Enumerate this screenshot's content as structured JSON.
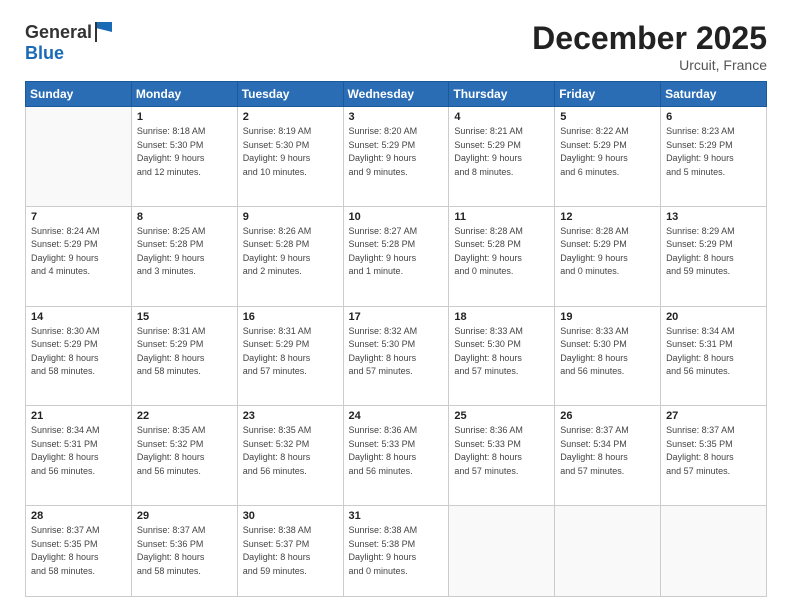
{
  "header": {
    "logo_line1": "General",
    "logo_line2": "Blue",
    "month": "December 2025",
    "location": "Urcuit, France"
  },
  "weekdays": [
    "Sunday",
    "Monday",
    "Tuesday",
    "Wednesday",
    "Thursday",
    "Friday",
    "Saturday"
  ],
  "weeks": [
    [
      {
        "day": "",
        "info": ""
      },
      {
        "day": "1",
        "info": "Sunrise: 8:18 AM\nSunset: 5:30 PM\nDaylight: 9 hours\nand 12 minutes."
      },
      {
        "day": "2",
        "info": "Sunrise: 8:19 AM\nSunset: 5:30 PM\nDaylight: 9 hours\nand 10 minutes."
      },
      {
        "day": "3",
        "info": "Sunrise: 8:20 AM\nSunset: 5:29 PM\nDaylight: 9 hours\nand 9 minutes."
      },
      {
        "day": "4",
        "info": "Sunrise: 8:21 AM\nSunset: 5:29 PM\nDaylight: 9 hours\nand 8 minutes."
      },
      {
        "day": "5",
        "info": "Sunrise: 8:22 AM\nSunset: 5:29 PM\nDaylight: 9 hours\nand 6 minutes."
      },
      {
        "day": "6",
        "info": "Sunrise: 8:23 AM\nSunset: 5:29 PM\nDaylight: 9 hours\nand 5 minutes."
      }
    ],
    [
      {
        "day": "7",
        "info": "Sunrise: 8:24 AM\nSunset: 5:29 PM\nDaylight: 9 hours\nand 4 minutes."
      },
      {
        "day": "8",
        "info": "Sunrise: 8:25 AM\nSunset: 5:28 PM\nDaylight: 9 hours\nand 3 minutes."
      },
      {
        "day": "9",
        "info": "Sunrise: 8:26 AM\nSunset: 5:28 PM\nDaylight: 9 hours\nand 2 minutes."
      },
      {
        "day": "10",
        "info": "Sunrise: 8:27 AM\nSunset: 5:28 PM\nDaylight: 9 hours\nand 1 minute."
      },
      {
        "day": "11",
        "info": "Sunrise: 8:28 AM\nSunset: 5:28 PM\nDaylight: 9 hours\nand 0 minutes."
      },
      {
        "day": "12",
        "info": "Sunrise: 8:28 AM\nSunset: 5:29 PM\nDaylight: 9 hours\nand 0 minutes."
      },
      {
        "day": "13",
        "info": "Sunrise: 8:29 AM\nSunset: 5:29 PM\nDaylight: 8 hours\nand 59 minutes."
      }
    ],
    [
      {
        "day": "14",
        "info": "Sunrise: 8:30 AM\nSunset: 5:29 PM\nDaylight: 8 hours\nand 58 minutes."
      },
      {
        "day": "15",
        "info": "Sunrise: 8:31 AM\nSunset: 5:29 PM\nDaylight: 8 hours\nand 58 minutes."
      },
      {
        "day": "16",
        "info": "Sunrise: 8:31 AM\nSunset: 5:29 PM\nDaylight: 8 hours\nand 57 minutes."
      },
      {
        "day": "17",
        "info": "Sunrise: 8:32 AM\nSunset: 5:30 PM\nDaylight: 8 hours\nand 57 minutes."
      },
      {
        "day": "18",
        "info": "Sunrise: 8:33 AM\nSunset: 5:30 PM\nDaylight: 8 hours\nand 57 minutes."
      },
      {
        "day": "19",
        "info": "Sunrise: 8:33 AM\nSunset: 5:30 PM\nDaylight: 8 hours\nand 56 minutes."
      },
      {
        "day": "20",
        "info": "Sunrise: 8:34 AM\nSunset: 5:31 PM\nDaylight: 8 hours\nand 56 minutes."
      }
    ],
    [
      {
        "day": "21",
        "info": "Sunrise: 8:34 AM\nSunset: 5:31 PM\nDaylight: 8 hours\nand 56 minutes."
      },
      {
        "day": "22",
        "info": "Sunrise: 8:35 AM\nSunset: 5:32 PM\nDaylight: 8 hours\nand 56 minutes."
      },
      {
        "day": "23",
        "info": "Sunrise: 8:35 AM\nSunset: 5:32 PM\nDaylight: 8 hours\nand 56 minutes."
      },
      {
        "day": "24",
        "info": "Sunrise: 8:36 AM\nSunset: 5:33 PM\nDaylight: 8 hours\nand 56 minutes."
      },
      {
        "day": "25",
        "info": "Sunrise: 8:36 AM\nSunset: 5:33 PM\nDaylight: 8 hours\nand 57 minutes."
      },
      {
        "day": "26",
        "info": "Sunrise: 8:37 AM\nSunset: 5:34 PM\nDaylight: 8 hours\nand 57 minutes."
      },
      {
        "day": "27",
        "info": "Sunrise: 8:37 AM\nSunset: 5:35 PM\nDaylight: 8 hours\nand 57 minutes."
      }
    ],
    [
      {
        "day": "28",
        "info": "Sunrise: 8:37 AM\nSunset: 5:35 PM\nDaylight: 8 hours\nand 58 minutes."
      },
      {
        "day": "29",
        "info": "Sunrise: 8:37 AM\nSunset: 5:36 PM\nDaylight: 8 hours\nand 58 minutes."
      },
      {
        "day": "30",
        "info": "Sunrise: 8:38 AM\nSunset: 5:37 PM\nDaylight: 8 hours\nand 59 minutes."
      },
      {
        "day": "31",
        "info": "Sunrise: 8:38 AM\nSunset: 5:38 PM\nDaylight: 9 hours\nand 0 minutes."
      },
      {
        "day": "",
        "info": ""
      },
      {
        "day": "",
        "info": ""
      },
      {
        "day": "",
        "info": ""
      }
    ]
  ]
}
